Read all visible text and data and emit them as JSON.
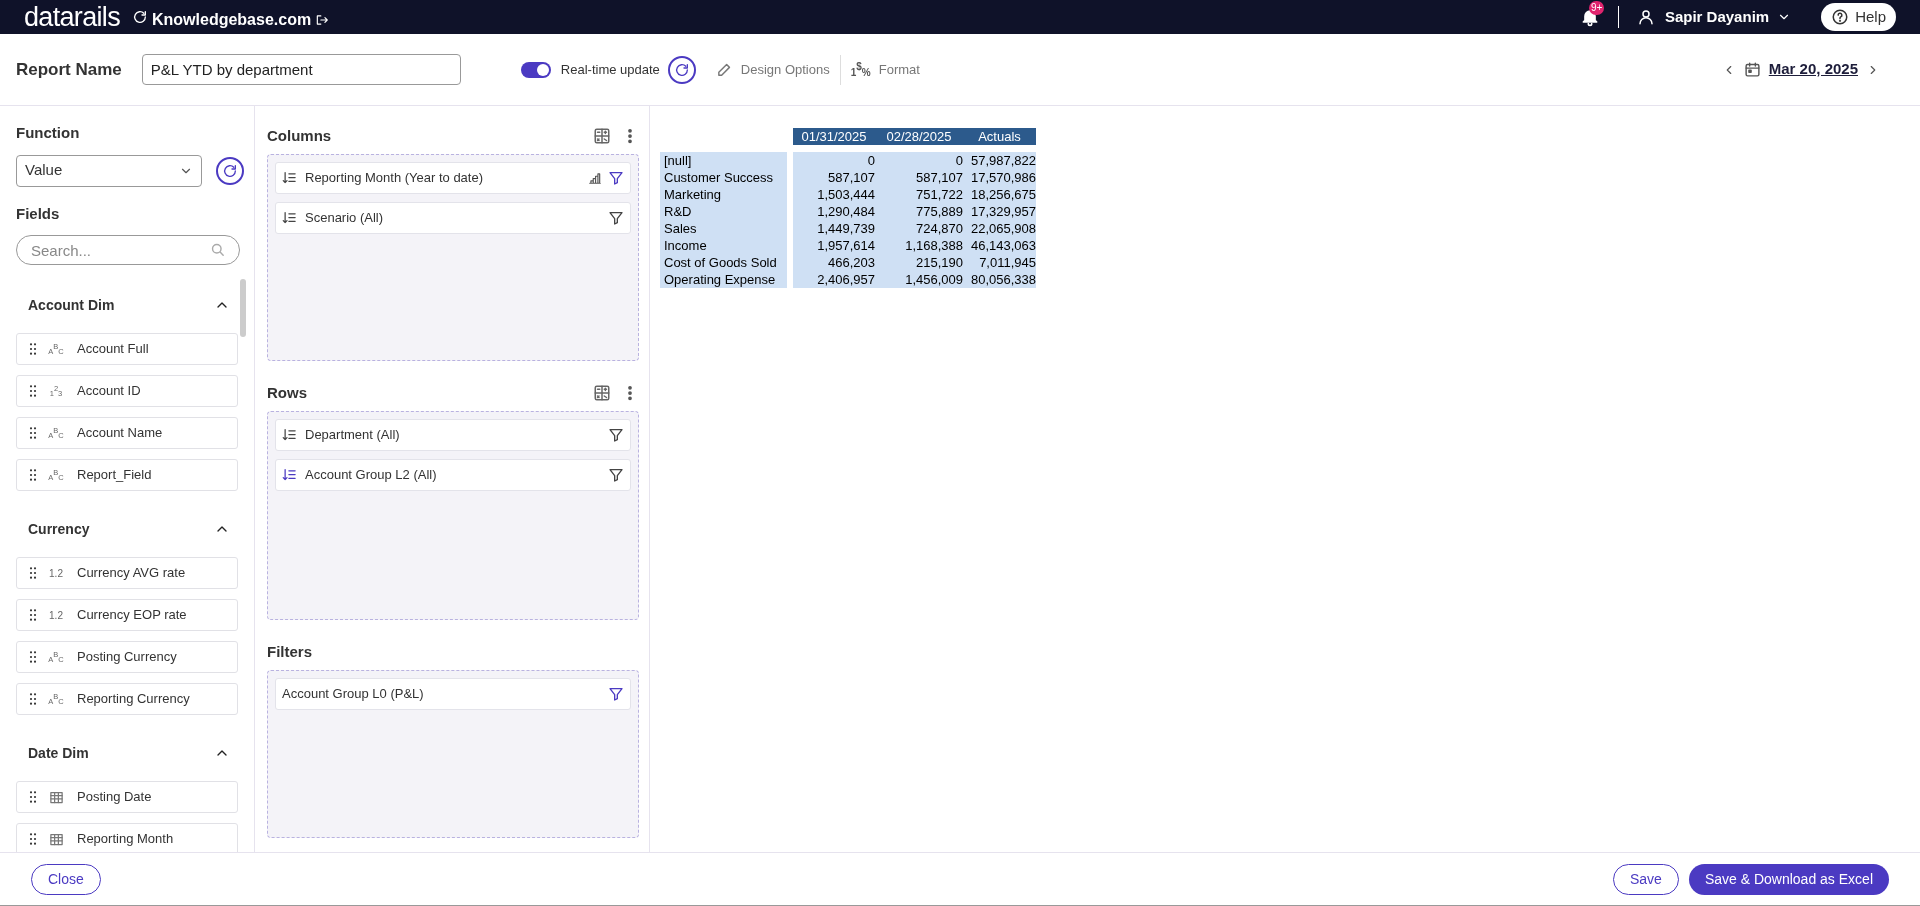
{
  "top_bar": {
    "logo": "datarails",
    "workspace": "Knowledgebase.com",
    "notifications_badge": "9+",
    "user": "Sapir Dayanim",
    "help": "Help"
  },
  "header": {
    "report_name_label": "Report Name",
    "report_name": "P&L YTD by department",
    "real_time_update": {
      "label": "Real-time update",
      "on": true
    },
    "design_options": "Design Options",
    "format": {
      "glyph": [
        "1",
        "$",
        "%"
      ],
      "label": "Format"
    },
    "date": "Mar 20, 2025"
  },
  "function": {
    "label": "Function",
    "value": "Value"
  },
  "fields": {
    "label": "Fields",
    "search_placeholder": "Search...",
    "sections": [
      {
        "title": "Account Dim",
        "expanded": true,
        "items": [
          {
            "kind": "text",
            "type_label": "$_{A}$$^{B}$$_{C}$",
            "name": "Account Full"
          },
          {
            "kind": "number",
            "type_label": "$_{1}$$^{2}$$_{3}$",
            "name": "Account ID"
          },
          {
            "kind": "text",
            "type_label": "$_{A}$$^{B}$$_{C}$",
            "name": "Account Name"
          },
          {
            "kind": "text",
            "type_label": "$_{A}$$^{B}$$_{C}$",
            "name": "Report_Field"
          }
        ]
      },
      {
        "title": "Currency",
        "expanded": true,
        "items": [
          {
            "kind": "decimal",
            "type_label": "1.2",
            "name": "Currency AVG rate"
          },
          {
            "kind": "decimal",
            "type_label": "1.2",
            "name": "Currency EOP rate"
          },
          {
            "kind": "text",
            "type_label": "$_{A}$$^{B}$$_{C}$",
            "name": "Posting Currency"
          },
          {
            "kind": "text",
            "type_label": "$_{A}$$^{B}$$_{C}$",
            "name": "Reporting Currency"
          }
        ]
      },
      {
        "title": "Date Dim",
        "expanded": true,
        "items": [
          {
            "kind": "date",
            "name": "Posting Date"
          },
          {
            "kind": "date",
            "name": "Reporting Month"
          }
        ]
      }
    ]
  },
  "zones": [
    {
      "title": "Columns",
      "kind": "axis",
      "items": [
        {
          "label": "Reporting Month (Year to date)",
          "sorted": true,
          "chart": true,
          "filter_active": true
        },
        {
          "label": "Scenario (All)",
          "sorted": true,
          "chart": false,
          "filter_active": false
        }
      ]
    },
    {
      "title": "Rows",
      "kind": "axis",
      "items": [
        {
          "label": "Department (All)",
          "sorted": true,
          "chart": false,
          "filter_active": false
        },
        {
          "label": "Account Group L2 (All)",
          "sorted": true,
          "chart": false,
          "filter_active": false
        }
      ]
    },
    {
      "title": "Filters",
      "kind": "filter",
      "items": [
        {
          "label": "Account Group L0 (P&L)",
          "sorted": false,
          "chart": false,
          "filter_active": true
        }
      ]
    }
  ],
  "table": {
    "columns": [
      "01/31/2025",
      "02/28/2025",
      "Actuals"
    ],
    "rows": [
      {
        "label": "[null]",
        "values": [
          "0",
          "0",
          "57,987,822"
        ]
      },
      {
        "label": "Customer Success",
        "values": [
          "587,107",
          "587,107",
          "17,570,986"
        ]
      },
      {
        "label": "Marketing",
        "values": [
          "1,503,444",
          "751,722",
          "18,256,675"
        ]
      },
      {
        "label": "R&D",
        "values": [
          "1,290,484",
          "775,889",
          "17,329,957"
        ]
      },
      {
        "label": "Sales",
        "values": [
          "1,449,739",
          "724,870",
          "22,065,908"
        ]
      },
      {
        "label": "Income",
        "values": [
          "1,957,614",
          "1,168,388",
          "46,143,063"
        ]
      },
      {
        "label": "Cost of Goods Sold",
        "values": [
          "466,203",
          "215,190",
          "7,011,945"
        ]
      },
      {
        "label": "Operating Expense",
        "values": [
          "2,406,957",
          "1,456,009",
          "80,056,338"
        ]
      }
    ]
  },
  "footer": {
    "close": "Close",
    "save": "Save",
    "save_download": "Save & Download as Excel"
  }
}
